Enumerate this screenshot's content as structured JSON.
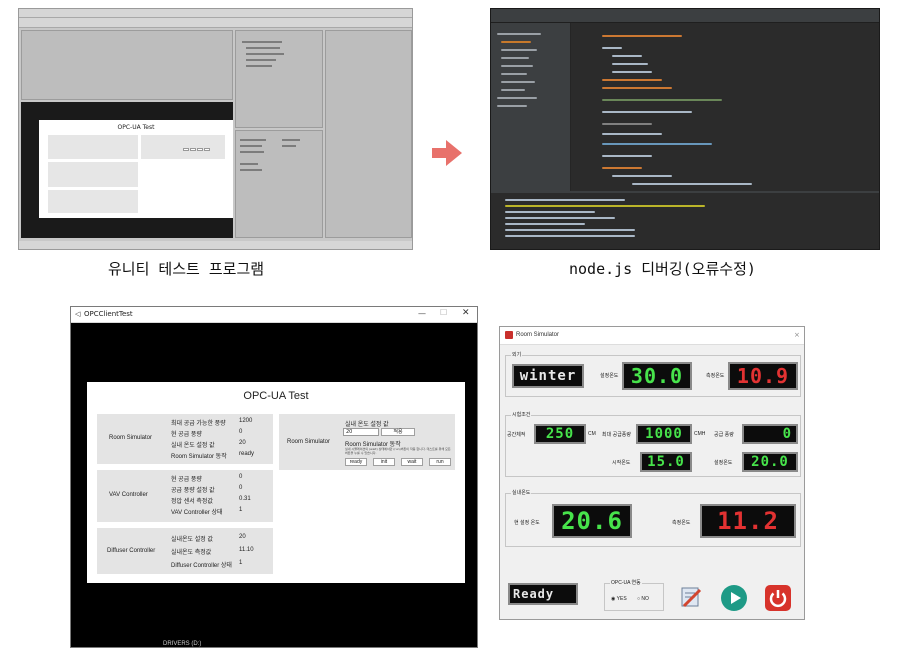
{
  "captions": {
    "unity": "유니티 테스트 프로그램",
    "nodejs": "node.js 디버깅(오류수정)"
  },
  "opc": {
    "window_title": "OPCClientTest",
    "panel_title": "OPC-UA Test",
    "room_simulator": {
      "label": "Room Simulator",
      "rows": [
        {
          "label": "최대 공급 가능한 풍량",
          "value": "1200"
        },
        {
          "label": "현 공급 풍량",
          "value": "0"
        },
        {
          "label": "실내 온도 설정 값",
          "value": "20"
        },
        {
          "label": "Room Simulator 동작",
          "value": "ready"
        }
      ]
    },
    "room_simulator_set": {
      "label": "Room Simulator",
      "title": "실내 온도 설정 값",
      "input_value": "20",
      "apply_label": "적용",
      "action_title": "Room Simulator 동작",
      "action_desc": "실내 시뮬레이션의 (wait) 상태에서만 (run)버튼이 작동 합니다. 테스트를 위해 모든 버튼을 누를 수 있습니다.",
      "buttons": [
        "ready",
        "init",
        "wait",
        "run"
      ]
    },
    "vav_controller": {
      "label": "VAV Controller",
      "rows": [
        {
          "label": "현 공급 풍량",
          "value": "0"
        },
        {
          "label": "공급 풍량 설정 값",
          "value": "0"
        },
        {
          "label": "정압 센서 측정값",
          "value": "0.31"
        },
        {
          "label": "VAV Controller 상태",
          "value": "1"
        }
      ]
    },
    "diffuser_controller": {
      "label": "Diffuser Controller",
      "rows": [
        {
          "label": "실내온도 설정 값",
          "value": "20"
        },
        {
          "label": "실내온도 측정값",
          "value": "11.10"
        },
        {
          "label": "Diffuser Controller 상태",
          "value": "1"
        }
      ]
    },
    "taskbar_label": "DRIVERS (D:)"
  },
  "roomsim": {
    "title": "Room Simulator",
    "season_group": "외기",
    "season_value": "winter",
    "setpoint_label": "설정온도",
    "setpoint_value": "30.0",
    "measured_label": "측정온도",
    "measured_value": "10.9",
    "cond_group": "시험조건",
    "space_volume_label": "공간체적",
    "space_volume_value": "250",
    "space_volume_unit": "CM",
    "max_supply_label": "최대 공급풍량",
    "max_supply_value": "1000",
    "max_supply_unit": "CMH",
    "supply_label": "공급 풍량",
    "supply_value": "0",
    "start_temp_label": "시작온도",
    "start_temp_value": "15.0",
    "set_temp_label": "설정온도",
    "set_temp_value": "20.0",
    "room_group": "실내온도",
    "cur_set_label": "현 설정 온도",
    "cur_set_value": "20.6",
    "room_measured_label": "측정온도",
    "room_measured_value": "11.2",
    "status_value": "Ready",
    "opcua_group": "OPC-UA 연동",
    "yes_label": "YES",
    "no_label": "NO"
  },
  "colors": {
    "seg_green": "#47e34b",
    "seg_red": "#e23232",
    "arrow": "#e8716b",
    "play": "#1e9a86",
    "power": "#d7332b"
  }
}
